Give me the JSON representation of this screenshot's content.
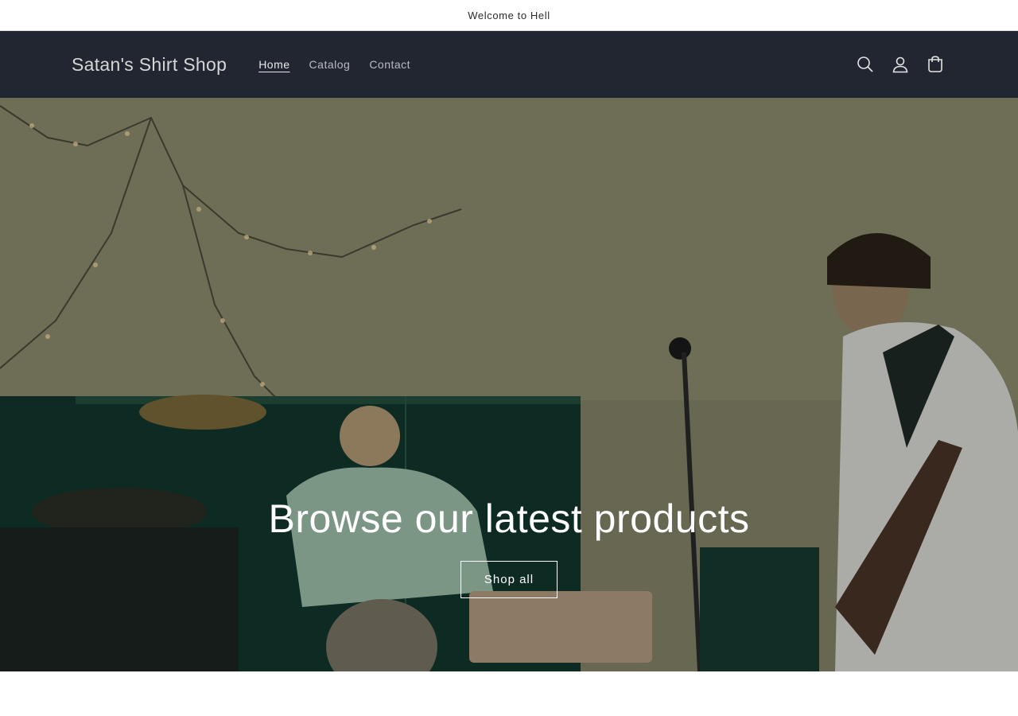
{
  "announcement": {
    "text": "Welcome to Hell"
  },
  "header": {
    "brand": "Satan's Shirt Shop",
    "nav": [
      {
        "label": "Home",
        "active": true
      },
      {
        "label": "Catalog",
        "active": false
      },
      {
        "label": "Contact",
        "active": false
      }
    ],
    "icons": [
      "search-icon",
      "account-icon",
      "cart-icon"
    ],
    "background_color": "#222631"
  },
  "hero": {
    "title": "Browse our latest products",
    "button_label": "Shop all"
  }
}
